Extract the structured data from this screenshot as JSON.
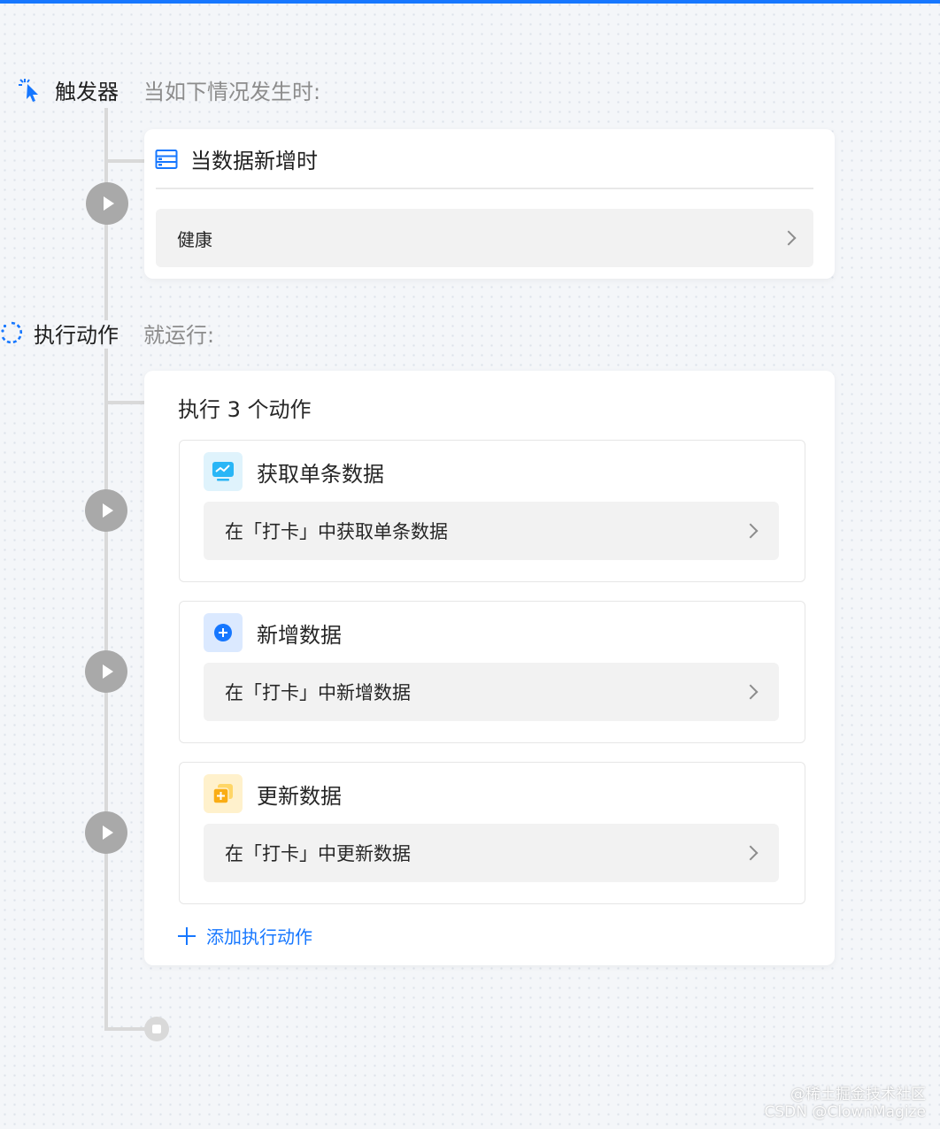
{
  "trigger_section": {
    "label": "触发器",
    "subtitle": "当如下情况发生时:"
  },
  "trigger_card": {
    "title": "当数据新增时",
    "row_value": "健康"
  },
  "action_section": {
    "label": "执行动作",
    "subtitle": "就运行:"
  },
  "action_card": {
    "count_label": "执行 3 个动作",
    "actions": [
      {
        "title": "获取单条数据",
        "description": "在「打卡」中获取单条数据",
        "icon": "chart-monitor-icon"
      },
      {
        "title": "新增数据",
        "description": "在「打卡」中新增数据",
        "icon": "plus-circle-icon"
      },
      {
        "title": "更新数据",
        "description": "在「打卡」中更新数据",
        "icon": "stacked-add-icon"
      }
    ],
    "add_label": "添加执行动作"
  },
  "watermark": {
    "line1": "@稀土掘金技术社区",
    "line2": "CSDN @ClownMagize"
  },
  "colors": {
    "accent": "#1677ff",
    "connector": "#d9d9d9",
    "step_dot": "#a9a9a9"
  }
}
